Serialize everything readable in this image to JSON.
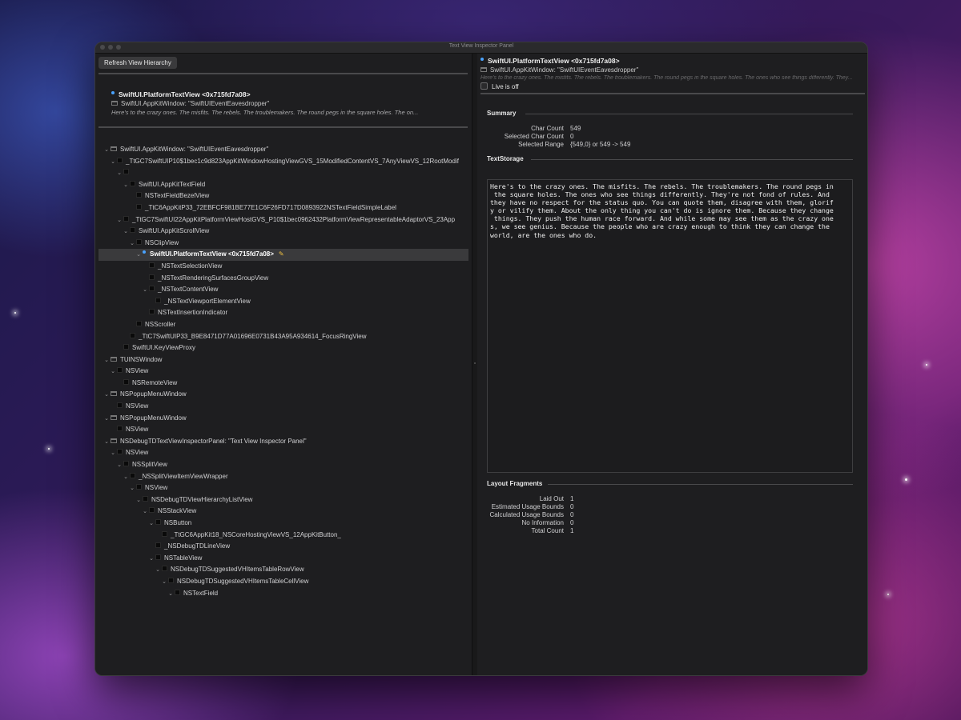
{
  "window": {
    "title": "Text View Inspector Panel"
  },
  "left": {
    "refresh_label": "Refresh View Hierarchy",
    "header": {
      "title": "SwiftUI.PlatformTextView <0x715fd7a08>",
      "window_line": "SwiftUI.AppKitWindow: \"SwiftUIEventEavesdropper\"",
      "preview": "Here's to the crazy ones. The misfits. The rebels. The troublemakers. The round pegs in the square holes. The on..."
    },
    "tree": [
      {
        "depth": 0,
        "chev": "⌄",
        "icon": "window",
        "label": "SwiftUI.AppKitWindow: \"SwiftUIEventEavesdropper\""
      },
      {
        "depth": 1,
        "chev": "⌄",
        "icon": "square",
        "label": "_TtGC7SwiftUIP10$1bec1c9d823AppKitWindowHostingViewGVS_15ModifiedContentVS_7AnyViewVS_12RootModif"
      },
      {
        "depth": 2,
        "chev": "⌄",
        "icon": "square",
        "label": ""
      },
      {
        "depth": 3,
        "chev": "⌄",
        "icon": "square",
        "label": "SwiftUI.AppKitTextField"
      },
      {
        "depth": 4,
        "chev": "",
        "icon": "square",
        "label": "NSTextFieldBezelView"
      },
      {
        "depth": 4,
        "chev": "",
        "icon": "square",
        "label": "_TtC6AppKitP33_72EBFCF981BE77E1C6F26FD717D0893922NSTextFieldSimpleLabel"
      },
      {
        "depth": 2,
        "chev": "⌄",
        "icon": "square",
        "label": "_TtGC7SwiftUI22AppKitPlatformViewHostGVS_P10$1bec0962432PlatformViewRepresentableAdaptorVS_23App"
      },
      {
        "depth": 3,
        "chev": "⌄",
        "icon": "square",
        "label": "SwiftUI.AppKitScrollView"
      },
      {
        "depth": 4,
        "chev": "⌄",
        "icon": "square",
        "label": "NSClipView"
      },
      {
        "depth": 5,
        "chev": "⌄",
        "icon": "dot",
        "label": "SwiftUI.PlatformTextView <0x715fd7a08>",
        "selected": true
      },
      {
        "depth": 6,
        "chev": "",
        "icon": "square",
        "label": "_NSTextSelectionView"
      },
      {
        "depth": 6,
        "chev": "",
        "icon": "square",
        "label": "_NSTextRenderingSurfacesGroupView"
      },
      {
        "depth": 6,
        "chev": "⌄",
        "icon": "square",
        "label": "_NSTextContentView"
      },
      {
        "depth": 7,
        "chev": "",
        "icon": "square",
        "label": "_NSTextViewportElementView"
      },
      {
        "depth": 6,
        "chev": "",
        "icon": "square",
        "label": "NSTextInsertionIndicator"
      },
      {
        "depth": 4,
        "chev": "",
        "icon": "square",
        "label": "NSScroller"
      },
      {
        "depth": 3,
        "chev": "",
        "icon": "square",
        "label": "_TtC7SwiftUIP33_B9E8471D77A01696E0731B43A95A934614_FocusRingView"
      },
      {
        "depth": 2,
        "chev": "",
        "icon": "square",
        "label": "SwiftUI.KeyViewProxy"
      },
      {
        "depth": 0,
        "chev": "⌄",
        "icon": "window",
        "label": "TUINSWindow"
      },
      {
        "depth": 1,
        "chev": "⌄",
        "icon": "square",
        "label": "NSView"
      },
      {
        "depth": 2,
        "chev": "",
        "icon": "square",
        "label": "NSRemoteView"
      },
      {
        "depth": 0,
        "chev": "⌄",
        "icon": "window",
        "label": "NSPopupMenuWindow"
      },
      {
        "depth": 1,
        "chev": "",
        "icon": "square",
        "label": "NSView"
      },
      {
        "depth": 0,
        "chev": "⌄",
        "icon": "window",
        "label": "NSPopupMenuWindow"
      },
      {
        "depth": 1,
        "chev": "",
        "icon": "square",
        "label": "NSView"
      },
      {
        "depth": 0,
        "chev": "⌄",
        "icon": "window",
        "label": "NSDebugTDTextViewInspectorPanel: \"Text View Inspector Panel\""
      },
      {
        "depth": 1,
        "chev": "⌄",
        "icon": "square",
        "label": "NSView"
      },
      {
        "depth": 2,
        "chev": "⌄",
        "icon": "square",
        "label": "NSSplitView"
      },
      {
        "depth": 3,
        "chev": "⌄",
        "icon": "square",
        "label": "_NSSplitViewItemViewWrapper"
      },
      {
        "depth": 4,
        "chev": "⌄",
        "icon": "square",
        "label": "NSView"
      },
      {
        "depth": 5,
        "chev": "⌄",
        "icon": "square",
        "label": "NSDebugTDViewHierarchyListView"
      },
      {
        "depth": 6,
        "chev": "⌄",
        "icon": "square",
        "label": "NSStackView"
      },
      {
        "depth": 7,
        "chev": "⌄",
        "icon": "square",
        "label": "NSButton"
      },
      {
        "depth": 8,
        "chev": "",
        "icon": "square",
        "label": "_TtGC6AppKit18_NSCoreHostingViewVS_12AppKitButton_"
      },
      {
        "depth": 7,
        "chev": "",
        "icon": "square",
        "label": "_NSDebugTDLineView"
      },
      {
        "depth": 7,
        "chev": "⌄",
        "icon": "square",
        "label": "NSTableView"
      },
      {
        "depth": 8,
        "chev": "⌄",
        "icon": "square",
        "label": "NSDebugTDSuggestedVHItemsTableRowView"
      },
      {
        "depth": 9,
        "chev": "⌄",
        "icon": "square",
        "label": "NSDebugTDSuggestedVHItemsTableCellView"
      },
      {
        "depth": 10,
        "chev": "⌄",
        "icon": "square",
        "label": "NSTextField"
      }
    ]
  },
  "right": {
    "header": {
      "title": "SwiftUI.PlatformTextView <0x715fd7a08>",
      "window_line": "SwiftUI.AppKitWindow: \"SwiftUIEventEavesdropper\"",
      "preview": "Here's to the crazy ones. The misfits. The rebels. The troublemakers. The round pegs in the square holes. The ones who see things differently. They...",
      "live_label": "Live is off"
    },
    "summary": {
      "heading": "Summary",
      "rows": [
        {
          "k": "Char Count",
          "v": "549"
        },
        {
          "k": "Selected Char Count",
          "v": "0"
        },
        {
          "k": "Selected Range",
          "v": "{549,0} or 549 -> 549"
        }
      ]
    },
    "textstorage": {
      "heading": "TextStorage",
      "text": "Here's to the crazy ones. The misfits. The rebels. The troublemakers. The round pegs in\n the square holes. The ones who see things differently. They're not fond of rules. And\nthey have no respect for the status quo. You can quote them, disagree with them, glorif\ny or vilify them. About the only thing you can't do is ignore them. Because they change\n things. They push the human race forward. And while some may see them as the crazy one\ns, we see genius. Because the people who are crazy enough to think they can change the\nworld, are the ones who do."
    },
    "layout": {
      "heading": "Layout Fragments",
      "rows": [
        {
          "k": "Laid Out",
          "v": "1"
        },
        {
          "k": "Estimated Usage Bounds",
          "v": "0"
        },
        {
          "k": "Calculated Usage Bounds",
          "v": "0"
        },
        {
          "k": "No Information",
          "v": "0"
        },
        {
          "k": "Total Count",
          "v": "1"
        }
      ]
    }
  }
}
